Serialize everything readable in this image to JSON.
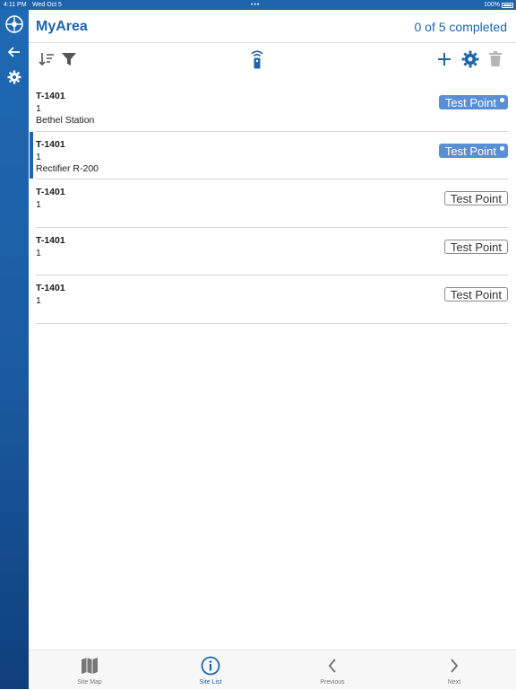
{
  "status_bar": {
    "time": "4:11 PM",
    "date": "Wed Oct 5",
    "battery": "100%"
  },
  "header": {
    "title": "MyArea",
    "progress": "0 of 5 completed"
  },
  "toolbar": {
    "icons": [
      "sort-icon",
      "filter-icon",
      "remote-icon",
      "add-icon",
      "settings-icon",
      "trash-icon"
    ]
  },
  "sites": [
    {
      "id": "T-1401",
      "num": "1",
      "name": "Bethel Station",
      "type": "Test Point",
      "active": true
    },
    {
      "id": "T-1401",
      "num": "1",
      "name": "Rectifier R-200",
      "type": "Test Point",
      "active": true,
      "selected": true
    },
    {
      "id": "T-1401",
      "num": "1",
      "name": "",
      "type": "Test Point",
      "active": false
    },
    {
      "id": "T-1401",
      "num": "1",
      "name": "",
      "type": "Test Point",
      "active": false
    },
    {
      "id": "T-1401",
      "num": "1",
      "name": "",
      "type": "Test Point",
      "active": false
    }
  ],
  "bottom_nav": {
    "items": [
      {
        "label": "Site Map",
        "icon": "map-icon"
      },
      {
        "label": "Site List",
        "icon": "info-icon",
        "active": true
      },
      {
        "label": "Previous",
        "icon": "chevron-left-icon"
      },
      {
        "label": "Next",
        "icon": "chevron-right-icon"
      }
    ]
  },
  "colors": {
    "primary": "#1d64ac",
    "badge_active": "#5a8fd6"
  }
}
